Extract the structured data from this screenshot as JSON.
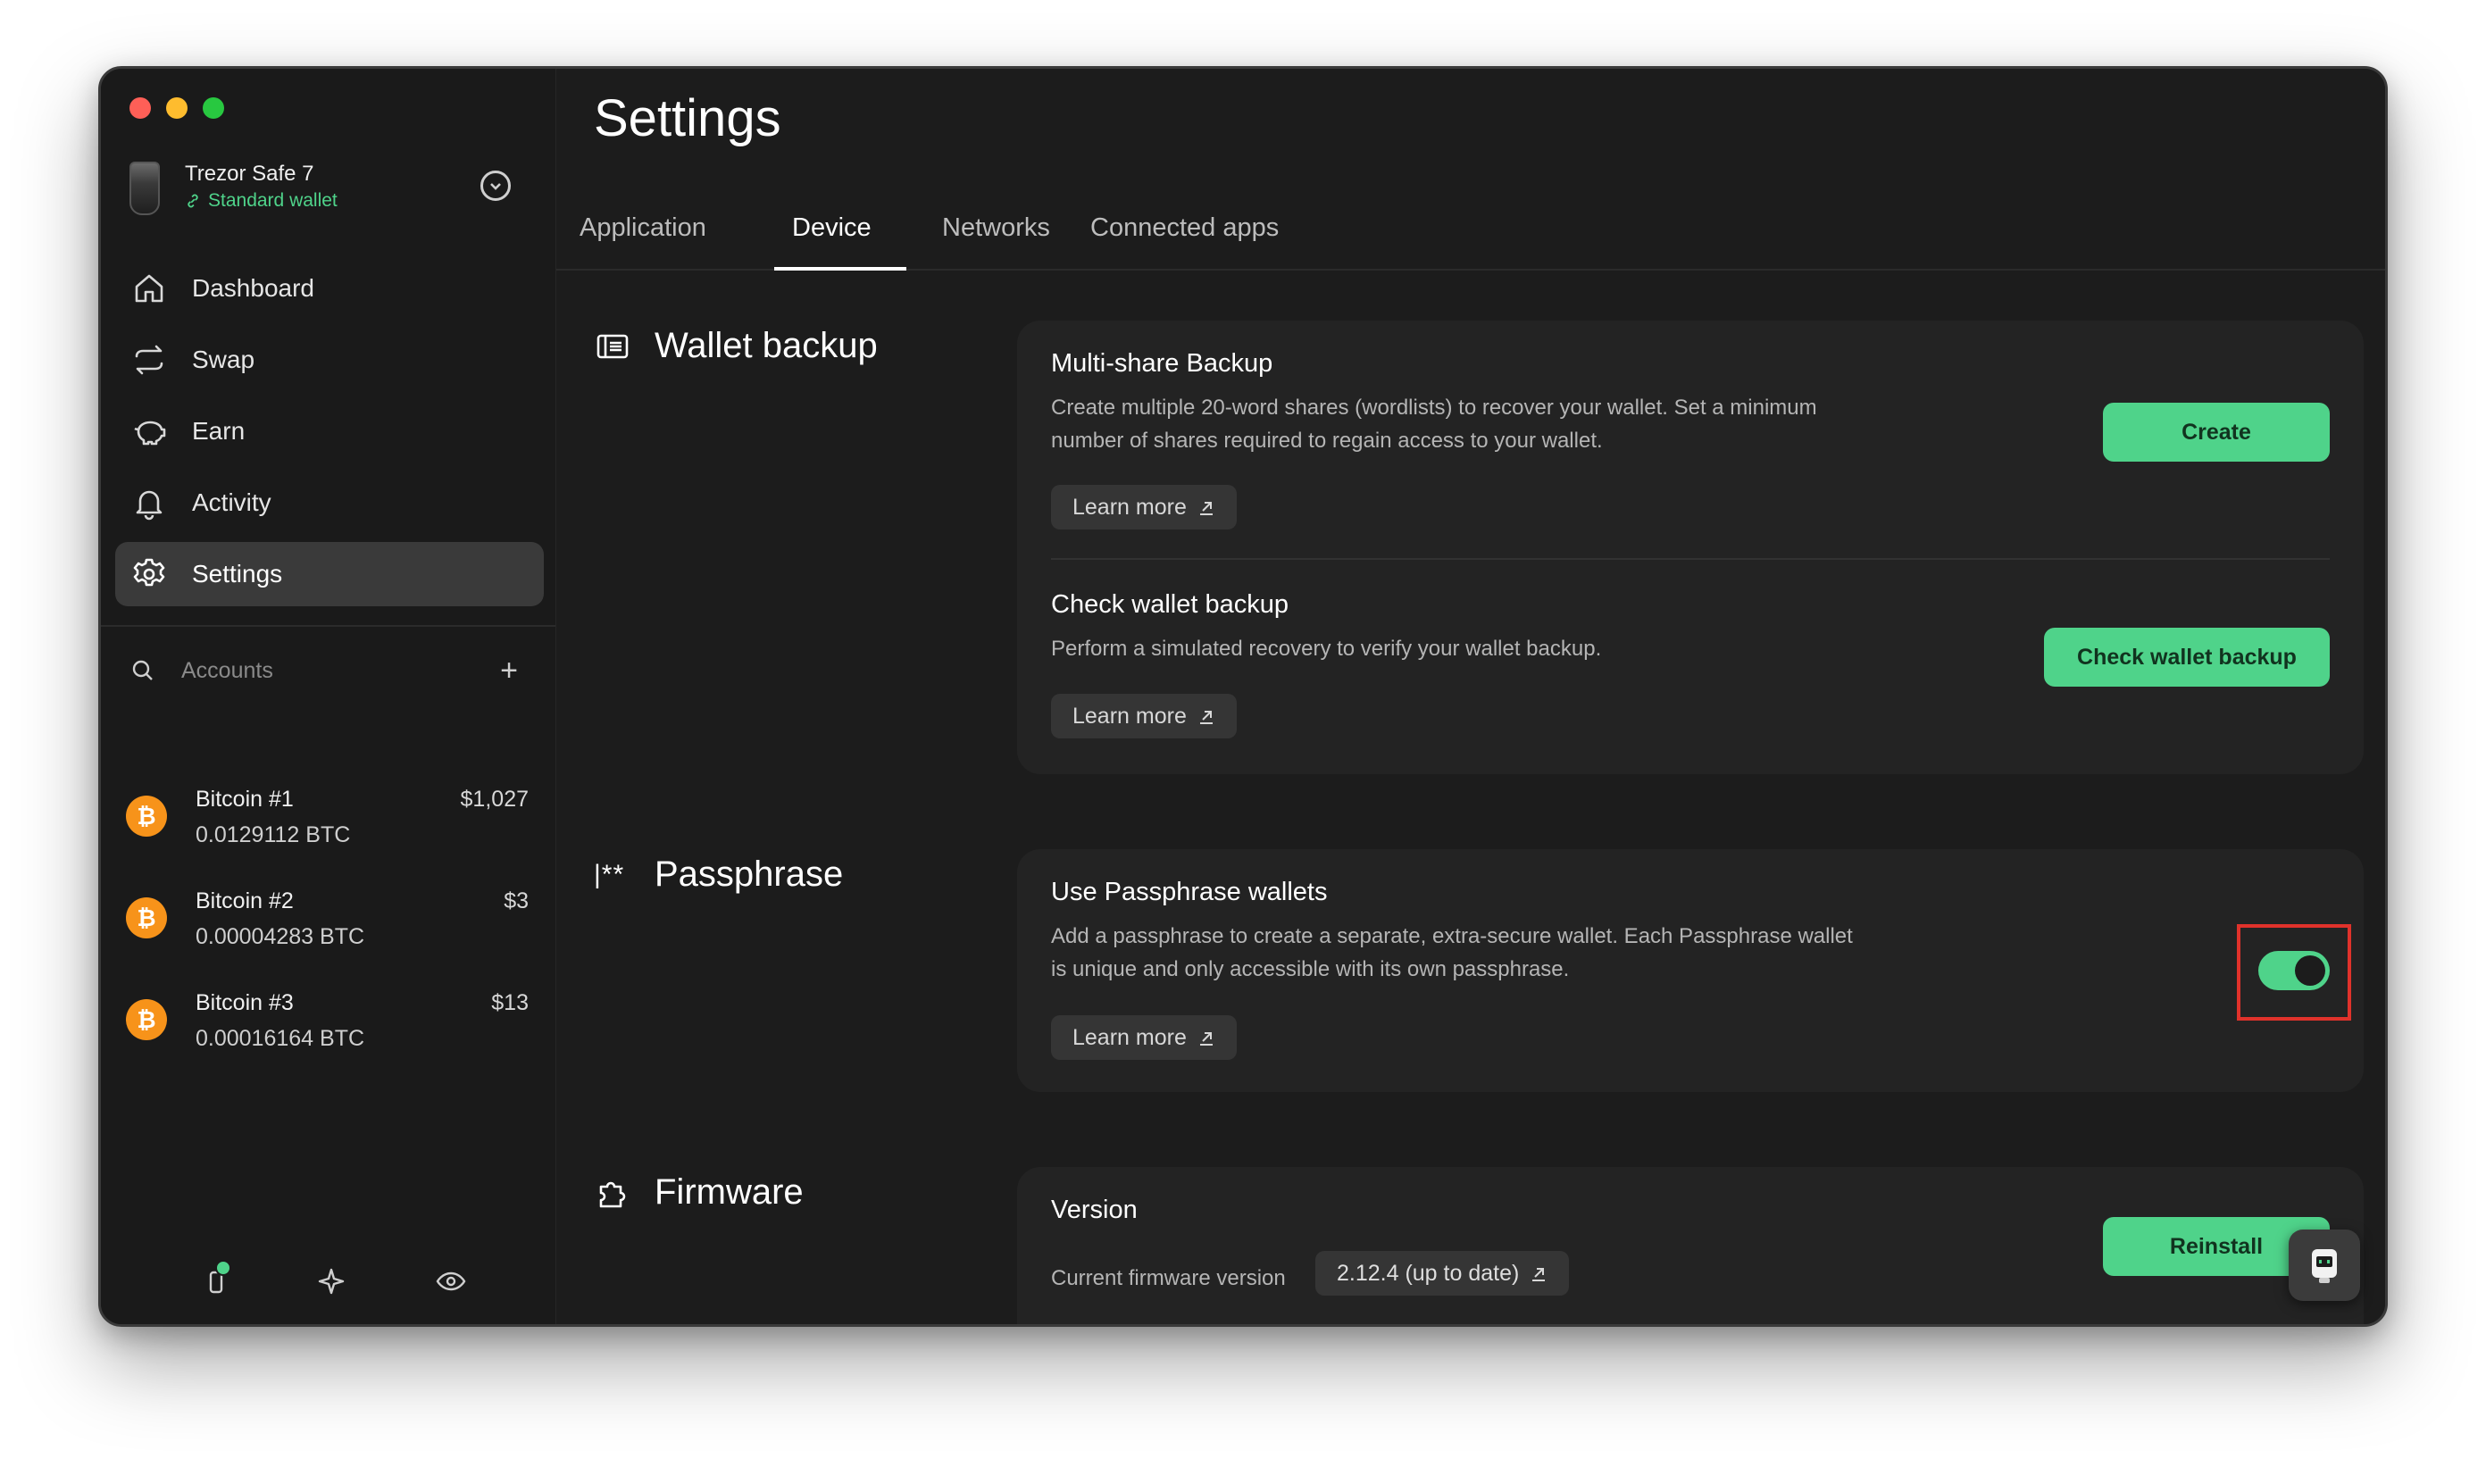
{
  "device": {
    "name": "Trezor Safe 7",
    "wallet_type": "Standard wallet"
  },
  "nav": [
    {
      "label": "Dashboard",
      "icon": "home-icon"
    },
    {
      "label": "Swap",
      "icon": "swap-icon"
    },
    {
      "label": "Earn",
      "icon": "piggy-bank-icon"
    },
    {
      "label": "Activity",
      "icon": "bell-icon"
    },
    {
      "label": "Settings",
      "icon": "gear-icon",
      "active": true
    }
  ],
  "accounts": {
    "label": "Accounts",
    "items": [
      {
        "name": "Bitcoin #1",
        "balance": "0.0129112 BTC",
        "fiat": "$1,027"
      },
      {
        "name": "Bitcoin #2",
        "balance": "0.00004283 BTC",
        "fiat": "$3"
      },
      {
        "name": "Bitcoin #3",
        "balance": "0.00016164 BTC",
        "fiat": "$13"
      }
    ]
  },
  "page": {
    "title": "Settings"
  },
  "tabs": [
    {
      "label": "Application"
    },
    {
      "label": "Device",
      "active": true
    },
    {
      "label": "Networks"
    },
    {
      "label": "Connected apps"
    }
  ],
  "sections": {
    "wallet_backup": {
      "label": "Wallet backup",
      "multishare": {
        "title": "Multi-share Backup",
        "description": "Create multiple 20-word shares (wordlists) to recover your wallet. Set a minimum number of shares required to regain access to your wallet.",
        "learn_more": "Learn more",
        "button": "Create"
      },
      "check": {
        "title": "Check wallet backup",
        "description": "Perform a simulated recovery to verify your wallet backup.",
        "learn_more": "Learn more",
        "button": "Check wallet backup"
      }
    },
    "passphrase": {
      "label": "Passphrase",
      "icon_text": "|**",
      "use": {
        "title": "Use Passphrase wallets",
        "description": "Add a passphrase to create a separate, extra-secure wallet. Each Passphrase wallet is unique and only accessible with its own passphrase.",
        "learn_more": "Learn more",
        "enabled": true
      }
    },
    "firmware": {
      "label": "Firmware",
      "version": {
        "title": "Version",
        "current_label": "Current firmware version",
        "current_value": "2.12.4 (up to date)",
        "button": "Reinstall"
      }
    }
  },
  "colors": {
    "accent": "#4fd38a",
    "background": "#1c1c1c",
    "card": "#232323",
    "highlight": "#e0322b",
    "bitcoin": "#f7931a"
  }
}
